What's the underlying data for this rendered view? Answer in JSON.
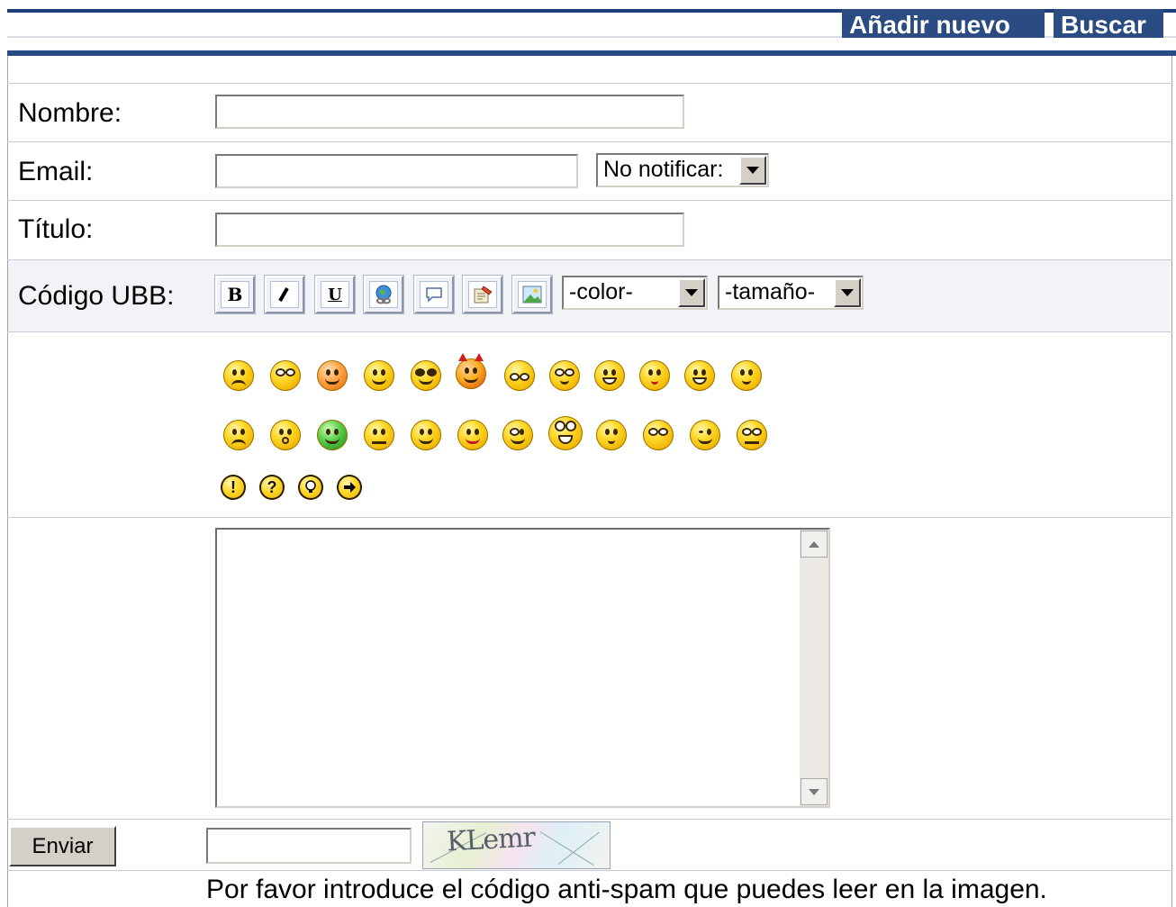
{
  "header": {
    "add_new_label": "Añadir nuevo",
    "search_label": "Buscar"
  },
  "form": {
    "name_label": "Nombre:",
    "name_value": "",
    "email_label": "Email:",
    "email_value": "",
    "notify_select_value": "No notificar:",
    "title_label": "Título:",
    "title_value": "",
    "ubb_label": "Código UBB:",
    "ubb_buttons": [
      "bold",
      "italic",
      "underline",
      "link",
      "quote",
      "code",
      "image"
    ],
    "color_select_value": "-color-",
    "size_select_value": "-tamaño-",
    "smileys_row1": [
      "angry",
      "eyes",
      "surprised",
      "smile",
      "glasses",
      "devil",
      "squint",
      "rolleyes",
      "grin",
      "kiss",
      "laugh",
      "dizzy"
    ],
    "smileys_row2": [
      "sad",
      "shocked",
      "sick",
      "neutral",
      "happy",
      "tongue",
      "wink-eye",
      "crazy",
      "thinking",
      "worried",
      "wink",
      "confused"
    ],
    "symbols": [
      "!",
      "?",
      "idea",
      "arrow"
    ],
    "message_value": "",
    "submit_label": "Enviar",
    "captcha_value": "",
    "captcha_image_text": "KLemr",
    "captcha_hint": "Por favor introduce el código anti-spam que puedes leer en la imagen."
  },
  "colors": {
    "nav_bg": "#2b4c82",
    "header_bar": "#254a86",
    "row_alt_bg": "#f1f3f7"
  }
}
